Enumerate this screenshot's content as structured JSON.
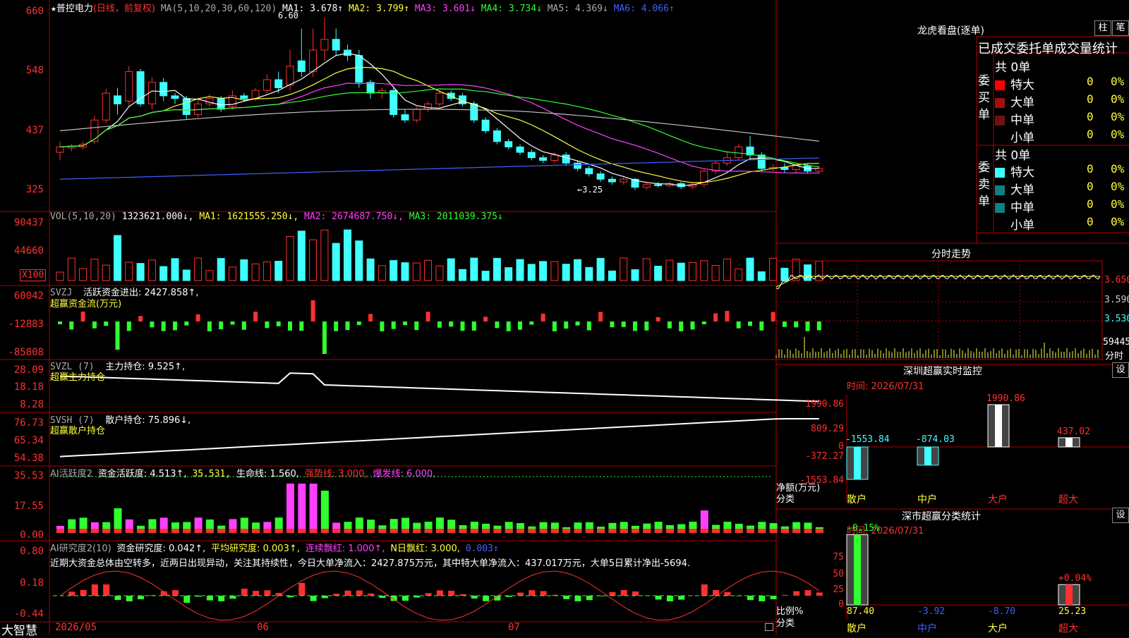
{
  "app": {
    "brand": "大智慧"
  },
  "colors": {
    "up": "#ff3030",
    "down": "#40ffff",
    "ma1": "#ffffff",
    "ma2": "#ffff40",
    "ma3": "#ff40ff",
    "ma4": "#30ff30",
    "ma5": "#c0c0c0",
    "ma6": "#4060ff"
  },
  "header": {
    "star": "★",
    "stock_name": "普控电力",
    "mode": "(日线，前复权)",
    "ma_spec": "MA(5,10,20,30,60,120)",
    "ma1": "MA1: 3.678↑",
    "ma2": "MA2: 3.799↑",
    "ma3": "MA3: 3.601↓",
    "ma4": "MA4: 3.734↓",
    "ma5": "MA5: 4.369↓",
    "ma6": "MA6: 4.066↑"
  },
  "price_axis": [
    "660",
    "548",
    "437",
    "325"
  ],
  "price_annot": {
    "high": "6.60",
    "low": "←3.25"
  },
  "vol_panel": {
    "title": "VOL(5,10,20)",
    "value": "1323621.000↓,",
    "ma1": "MA1: 1621555.250↓,",
    "ma2": "MA2: 2674687.750↓,",
    "ma3": "MA3: 2011039.375↓",
    "axis": [
      "90437",
      "44660"
    ],
    "unit": "X100"
  },
  "svzj_panel": {
    "title": "SVZJ",
    "label": "活跃资金进出: 2427.858↑,",
    "sub": "超赢资金流(万元)",
    "axis": [
      "60042",
      "-12883",
      "-85808"
    ]
  },
  "svzl_panel": {
    "title": "SVZL (7)",
    "label": "主力持仓: 9.525↑,",
    "sub": "超赢主力持仓",
    "axis": [
      "28.09",
      "18.18",
      "8.28"
    ]
  },
  "svsh_panel": {
    "title": "SVSH (7)",
    "label": "散户持仓: 75.896↓,",
    "sub": "超赢散户持仓",
    "axis": [
      "76.73",
      "65.34",
      "54.38"
    ]
  },
  "ai2_panel": {
    "title": "AI活跃度2",
    "label": "资金活跃度: 4.513↑,",
    "v2": "35.531,",
    "life": "生命线: 1.560,",
    "strong": "强势线: 3.000,",
    "burst": "爆发线: 6.000,",
    "axis": [
      "35.53",
      "17.55",
      "0.00"
    ]
  },
  "ai_research": {
    "title": "AI研究度2(10)",
    "label": "资金研究度: 0.042↑,",
    "avg": "平均研究度: 0.003↑,",
    "cont": "连续飘红: 1.000↑,",
    "nday": "N日飘红: 3.000,",
    "last": "0.003↑",
    "axis": [
      "0.80",
      "0.18",
      "-0.44"
    ],
    "comment": "近期大资金总体由空转多，近两日出现异动，关注其持续性，今日大单净流入：2427.875万元，其中特大单净流入：437.017万元，大单5日累计净出-5694."
  },
  "x_axis": [
    "2026/05",
    "06",
    "07"
  ],
  "lhb": {
    "title": "龙虎看盘(逐单)",
    "btn1": "柱",
    "btn2": "笔",
    "heading": "已成交委托单成交量统计",
    "buy_label": "委买单",
    "sell_label": "委卖单",
    "buy_total": "共 0单",
    "sell_total": "共 0单",
    "rows_buy": [
      {
        "name": "特大",
        "v": "0",
        "p": "0%",
        "color": "#ff0000"
      },
      {
        "name": "大单",
        "v": "0",
        "p": "0%",
        "color": "#a01010"
      },
      {
        "name": "中单",
        "v": "0",
        "p": "0%",
        "color": "#701010"
      },
      {
        "name": "小单",
        "v": "0",
        "p": "0%",
        "color": ""
      }
    ],
    "rows_sell": [
      {
        "name": "特大",
        "v": "0",
        "p": "0%",
        "color": "#40ffff"
      },
      {
        "name": "大单",
        "v": "0",
        "p": "0%",
        "color": "#108080"
      },
      {
        "name": "中单",
        "v": "0",
        "p": "0%",
        "color": "#108080"
      },
      {
        "name": "小单",
        "v": "0",
        "p": "0%",
        "color": ""
      }
    ]
  },
  "fenshi": {
    "title": "分时走势",
    "axis": [
      "3.650",
      "3.590",
      "3.530"
    ],
    "vol": "59445",
    "vol_lbl": "分时"
  },
  "sz_monitor": {
    "title": "深圳超赢实时监控",
    "btn": "设",
    "time": "时间: 2026/07/31",
    "axis": [
      "1990.86",
      "809.29",
      "0",
      "-372.27",
      "-1553.84"
    ],
    "y_label": "净额(万元)",
    "x_label": "分类",
    "categories": [
      "散户",
      "中户",
      "大户",
      "超大"
    ],
    "values": [
      -1553.84,
      -874.03,
      1990.86,
      437.02
    ],
    "value_labels": [
      "-1553.84",
      "-874.03",
      "1990.86",
      "437.02"
    ]
  },
  "sz_class": {
    "title": "深市超赢分类统计",
    "btn": "设",
    "time": "时间: 2026/07/31",
    "axis": [
      "75",
      "50",
      "25",
      "0"
    ],
    "y_label": "比例%",
    "x_label": "分类",
    "categories": [
      "散户",
      "中户",
      "大户",
      "超大"
    ],
    "top_labels": [
      "-0.15%",
      "",
      "",
      "+0.04%"
    ],
    "bottom_labels": [
      "87.40",
      "-3.92",
      "-8.70",
      "25.23"
    ],
    "values": [
      87.4,
      0,
      0,
      25.23
    ]
  },
  "chart_data": [
    {
      "type": "candlestick",
      "title": "普控电力",
      "series_note": "daily OHLC (price ×100 on axis)",
      "ylim": [
        300,
        680
      ],
      "candles": [
        [
          410,
          420,
          395,
          430
        ],
        [
          418,
          422,
          412,
          426
        ],
        [
          420,
          425,
          415,
          430
        ],
        [
          430,
          470,
          425,
          478
        ],
        [
          470,
          520,
          465,
          528
        ],
        [
          515,
          500,
          480,
          530
        ],
        [
          505,
          560,
          495,
          570
        ],
        [
          560,
          500,
          495,
          565
        ],
        [
          500,
          540,
          490,
          550
        ],
        [
          540,
          515,
          505,
          548
        ],
        [
          515,
          510,
          500,
          520
        ],
        [
          510,
          480,
          470,
          515
        ],
        [
          480,
          500,
          475,
          508
        ],
        [
          500,
          510,
          495,
          518
        ],
        [
          510,
          490,
          485,
          515
        ],
        [
          495,
          515,
          490,
          525
        ],
        [
          515,
          510,
          505,
          520
        ],
        [
          510,
          525,
          505,
          530
        ],
        [
          525,
          545,
          520,
          555
        ],
        [
          545,
          530,
          520,
          560
        ],
        [
          535,
          570,
          525,
          600
        ],
        [
          580,
          560,
          550,
          640
        ],
        [
          560,
          600,
          550,
          640
        ],
        [
          600,
          620,
          580,
          660
        ],
        [
          620,
          600,
          590,
          640
        ],
        [
          600,
          590,
          580,
          610
        ],
        [
          590,
          540,
          530,
          600
        ],
        [
          540,
          520,
          510,
          545
        ],
        [
          520,
          525,
          510,
          530
        ],
        [
          525,
          480,
          475,
          530
        ],
        [
          480,
          470,
          465,
          490
        ],
        [
          470,
          490,
          465,
          495
        ],
        [
          490,
          500,
          485,
          505
        ],
        [
          500,
          520,
          495,
          525
        ],
        [
          520,
          510,
          505,
          525
        ],
        [
          515,
          500,
          495,
          520
        ],
        [
          500,
          470,
          465,
          505
        ],
        [
          470,
          450,
          445,
          475
        ],
        [
          450,
          430,
          425,
          455
        ],
        [
          430,
          420,
          415,
          435
        ],
        [
          420,
          410,
          405,
          425
        ],
        [
          410,
          400,
          395,
          415
        ],
        [
          400,
          395,
          390,
          405
        ],
        [
          395,
          405,
          390,
          410
        ],
        [
          405,
          390,
          385,
          410
        ],
        [
          390,
          380,
          375,
          395
        ],
        [
          380,
          370,
          365,
          385
        ],
        [
          370,
          360,
          355,
          375
        ],
        [
          360,
          355,
          350,
          365
        ],
        [
          355,
          360,
          350,
          365
        ],
        [
          360,
          345,
          340,
          362
        ],
        [
          345,
          350,
          340,
          355
        ],
        [
          350,
          348,
          345,
          355
        ],
        [
          348,
          352,
          345,
          356
        ],
        [
          352,
          346,
          342,
          355
        ],
        [
          346,
          350,
          342,
          354
        ],
        [
          350,
          375,
          345,
          380
        ],
        [
          375,
          390,
          370,
          395
        ],
        [
          390,
          400,
          385,
          410
        ],
        [
          400,
          420,
          395,
          425
        ],
        [
          420,
          405,
          398,
          440
        ],
        [
          405,
          380,
          375,
          410
        ],
        [
          380,
          382,
          375,
          388
        ],
        [
          382,
          378,
          372,
          390
        ],
        [
          378,
          385,
          372,
          390
        ],
        [
          385,
          375,
          370,
          388
        ],
        [
          375,
          380,
          370,
          385
        ]
      ]
    },
    {
      "type": "bar",
      "title": "VOL(5,10,20)",
      "ylabel": "X100",
      "ylim": [
        0,
        95000
      ]
    },
    {
      "type": "bar",
      "title": "SVZJ 活跃资金进出",
      "ylim": [
        -85808,
        60042
      ]
    },
    {
      "type": "line",
      "title": "SVZL 主力持仓",
      "ylim": [
        8.28,
        28.09
      ]
    },
    {
      "type": "line",
      "title": "SVSH 散户持仓",
      "ylim": [
        54.38,
        76.73
      ]
    },
    {
      "type": "bar",
      "title": "AI活跃度2",
      "ylim": [
        0,
        35.53
      ]
    },
    {
      "type": "bar",
      "title": "AI研究度2(10)",
      "ylim": [
        -0.44,
        0.8
      ]
    },
    {
      "type": "bar",
      "title": "深圳超赢实时监控",
      "categories": [
        "散户",
        "中户",
        "大户",
        "超大"
      ],
      "values": [
        -1553.84,
        -874.03,
        1990.86,
        437.02
      ],
      "ylim": [
        -1553.84,
        1990.86
      ]
    },
    {
      "type": "bar",
      "title": "深市超赢分类统计",
      "categories": [
        "散户",
        "中户",
        "大户",
        "超大"
      ],
      "values": [
        87.4,
        -3.92,
        -8.7,
        25.23
      ],
      "ylim": [
        0,
        100
      ]
    }
  ]
}
